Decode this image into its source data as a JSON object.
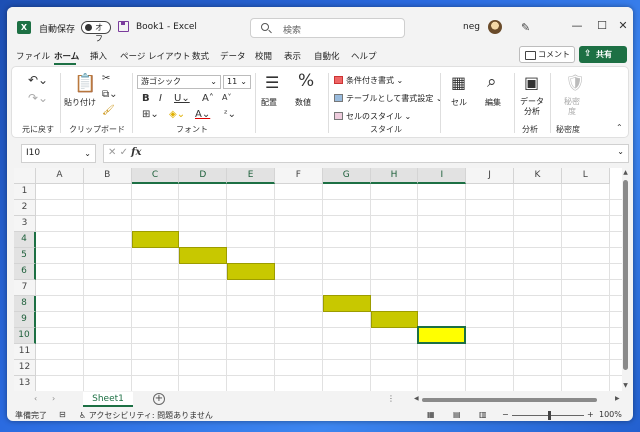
{
  "app": {
    "logo": "X",
    "autosave_label": "自動保存",
    "autosave_state": "オフ",
    "doc_title": "Book1  -  Excel",
    "search_placeholder": "検索",
    "user_name": "neg",
    "window_controls": [
      "minimize-icon",
      "maximize-icon",
      "close-icon"
    ]
  },
  "tabs": [
    "ファイル",
    "ホーム",
    "挿入",
    "ページ レイアウト",
    "数式",
    "データ",
    "校閲",
    "表示",
    "自動化",
    "ヘルプ"
  ],
  "active_tab": "ホーム",
  "buttons": {
    "comment": "コメント",
    "share": "共有"
  },
  "ribbon": {
    "groups": [
      "元に戻す",
      "クリップボード",
      "フォント",
      "スタイル",
      "分析",
      "秘密度"
    ],
    "paste": "貼り付け",
    "font_name": "游ゴシック",
    "font_size": "11",
    "align": "配置",
    "number": "数値",
    "conditional_format": "条件付き書式",
    "table_format": "テーブルとして書式設定",
    "cell_style": "セルのスタイル",
    "cells": "セル",
    "edit": "編集",
    "data_analysis": "データ\n分析",
    "sensitivity": "秘密\n度"
  },
  "formula_bar": {
    "name_box": "I10",
    "formula": "",
    "fx": "fx"
  },
  "grid": {
    "columns": [
      "A",
      "B",
      "C",
      "D",
      "E",
      "F",
      "G",
      "H",
      "I",
      "J",
      "K",
      "L"
    ],
    "rows": [
      "1",
      "2",
      "3",
      "4",
      "5",
      "6",
      "7",
      "8",
      "9",
      "10",
      "11",
      "12",
      "13"
    ],
    "highlight_color": "#c8c800",
    "active_fill_color": "#ffff00",
    "filled_cells": [
      "C4",
      "D5",
      "E6",
      "G8",
      "H9",
      "I10"
    ],
    "active_cell": "I10"
  },
  "sheets": {
    "tabs": [
      "Sheet1"
    ],
    "active": "Sheet1"
  },
  "status": {
    "ready": "準備完了",
    "accessibility": "アクセシビリティ: 問題ありません",
    "zoom": "100%"
  }
}
